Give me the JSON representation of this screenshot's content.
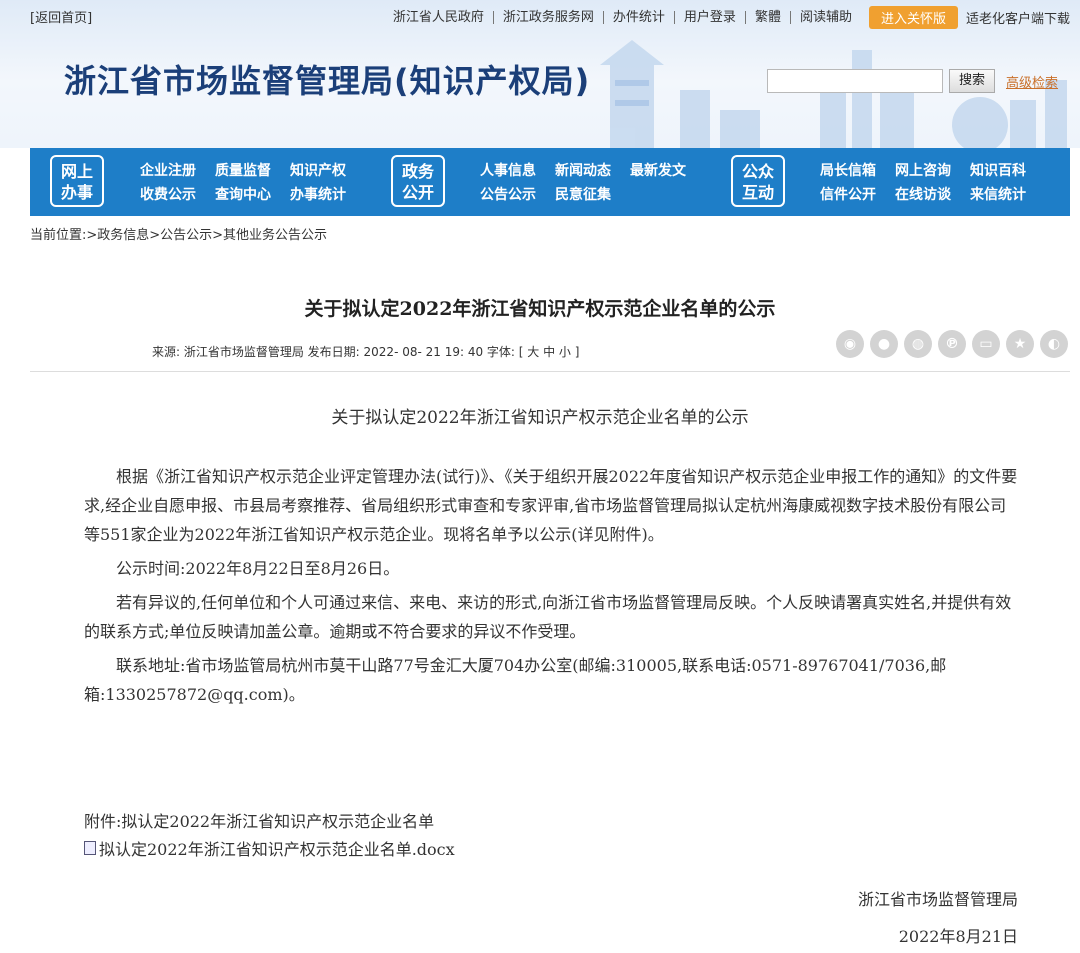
{
  "topbar": {
    "back": "[返回首页]",
    "links": [
      "浙江省人民政府",
      "浙江政务服务网",
      "办件统计",
      "用户登录",
      "繁體",
      "阅读辅助"
    ],
    "care_mode": "进入关怀版",
    "elder_app": "适老化客户端下载"
  },
  "header": {
    "title": "浙江省市场监督管理局(知识产权局)",
    "search_button": "搜索",
    "advanced_search": "高级检索"
  },
  "nav": {
    "sections": [
      {
        "box": [
          "网上",
          "办事"
        ],
        "links": [
          [
            "企业注册",
            "质量监督",
            "知识产权"
          ],
          [
            "收费公示",
            "查询中心",
            "办事统计"
          ]
        ]
      },
      {
        "box": [
          "政务",
          "公开"
        ],
        "links": [
          [
            "人事信息",
            "新闻动态",
            "最新发文"
          ],
          [
            "公告公示",
            "民意征集"
          ]
        ]
      },
      {
        "box": [
          "公众",
          "互动"
        ],
        "links": [
          [
            "局长信箱",
            "网上咨询",
            "知识百科"
          ],
          [
            "信件公开",
            "在线访谈",
            "来信统计"
          ]
        ]
      }
    ]
  },
  "breadcrumb": "当前位置:>政务信息>公告公示>其他业务公告公示",
  "article": {
    "title": "关于拟认定2022年浙江省知识产权示范企业名单的公示",
    "meta": "来源:  浙江省市场监督管理局 发布日期:  2022- 08- 21 19: 40 字体: [ 大 中 小 ]",
    "share_icons": [
      "weibo-icon",
      "qq-icon",
      "wechat-icon",
      "pinterest-icon",
      "douban-icon",
      "qzone-icon",
      "renren-icon"
    ],
    "subtitle": "关于拟认定2022年浙江省知识产权示范企业名单的公示",
    "paragraphs": [
      "根据《浙江省知识产权示范企业评定管理办法(试行)》、《关于组织开展2022年度省知识产权示范企业申报工作的通知》的文件要求,经企业自愿申报、市县局考察推荐、省局组织形式审查和专家评审,省市场监督管理局拟认定杭州海康威视数字技术股份有限公司等551家企业为2022年浙江省知识产权示范企业。现将名单予以公示(详见附件)。",
      "公示时间:2022年8月22日至8月26日。",
      "若有异议的,任何单位和个人可通过来信、来电、来访的形式,向浙江省市场监督管理局反映。个人反映请署真实姓名,并提供有效的联系方式;单位反映请加盖公章。逾期或不符合要求的异议不作受理。",
      "联系地址:省市场监管局杭州市莫干山路77号金汇大厦704办公室(邮编:310005,联系电话:0571-89767041/7036,邮箱:1330257872@qq.com)。"
    ],
    "attachment_label": "附件:拟认定2022年浙江省知识产权示范企业名单",
    "attachment_file": "拟认定2022年浙江省知识产权示范企业名单.docx",
    "signer": "浙江省市场监督管理局",
    "date": "2022年8月21日"
  }
}
